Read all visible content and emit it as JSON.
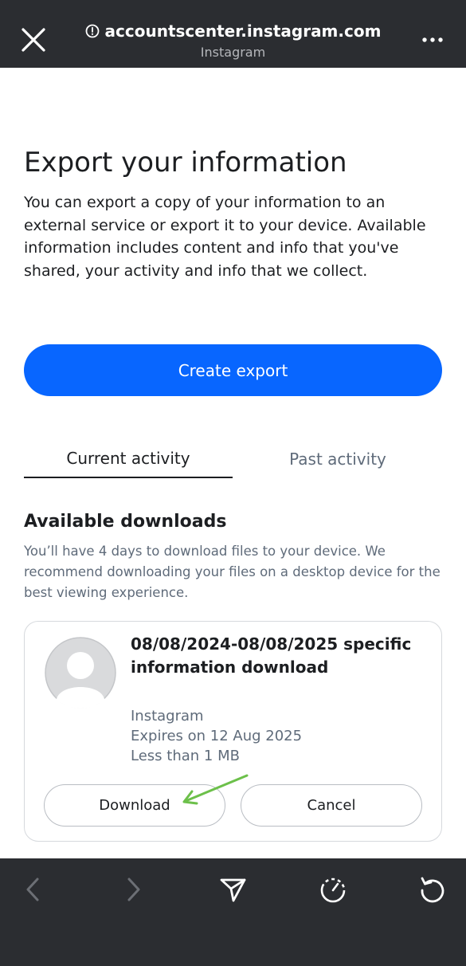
{
  "browser": {
    "url": "accountscenter.instagram.com",
    "site_name": "Instagram",
    "icons": {
      "close": "close-icon",
      "info": "info-icon",
      "more": "more-icon",
      "back": "chevron-left-icon",
      "forward": "chevron-right-icon",
      "share": "send-icon",
      "timer": "stopwatch-icon",
      "reload": "reload-icon"
    },
    "colors": {
      "bar": "#2b2d31",
      "icon": "#ffffff",
      "disabled_icon": "#6c6f75"
    }
  },
  "page": {
    "title": "Export your information",
    "intro": "You can export a copy of your information to an external service or export it to your device. Available information includes content and info that you've shared, your activity and info that we collect.",
    "create_button": "Create export",
    "accent_color": "#0866ff"
  },
  "tabs": [
    {
      "label": "Current activity",
      "selected": true
    },
    {
      "label": "Past activity",
      "selected": false
    }
  ],
  "downloads": {
    "heading": "Available downloads",
    "description": "You’ll have 4 days to download files to your device. We recommend downloading your files on a desktop device for the best viewing experience.",
    "items": [
      {
        "title": "08/08/2024-08/08/2025 specific information download",
        "source": "Instagram",
        "expires": "Expires on 12 Aug 2025",
        "size": "Less than 1 MB",
        "download_label": "Download",
        "cancel_label": "Cancel"
      }
    ],
    "annotation_color": "#6cc04a"
  }
}
